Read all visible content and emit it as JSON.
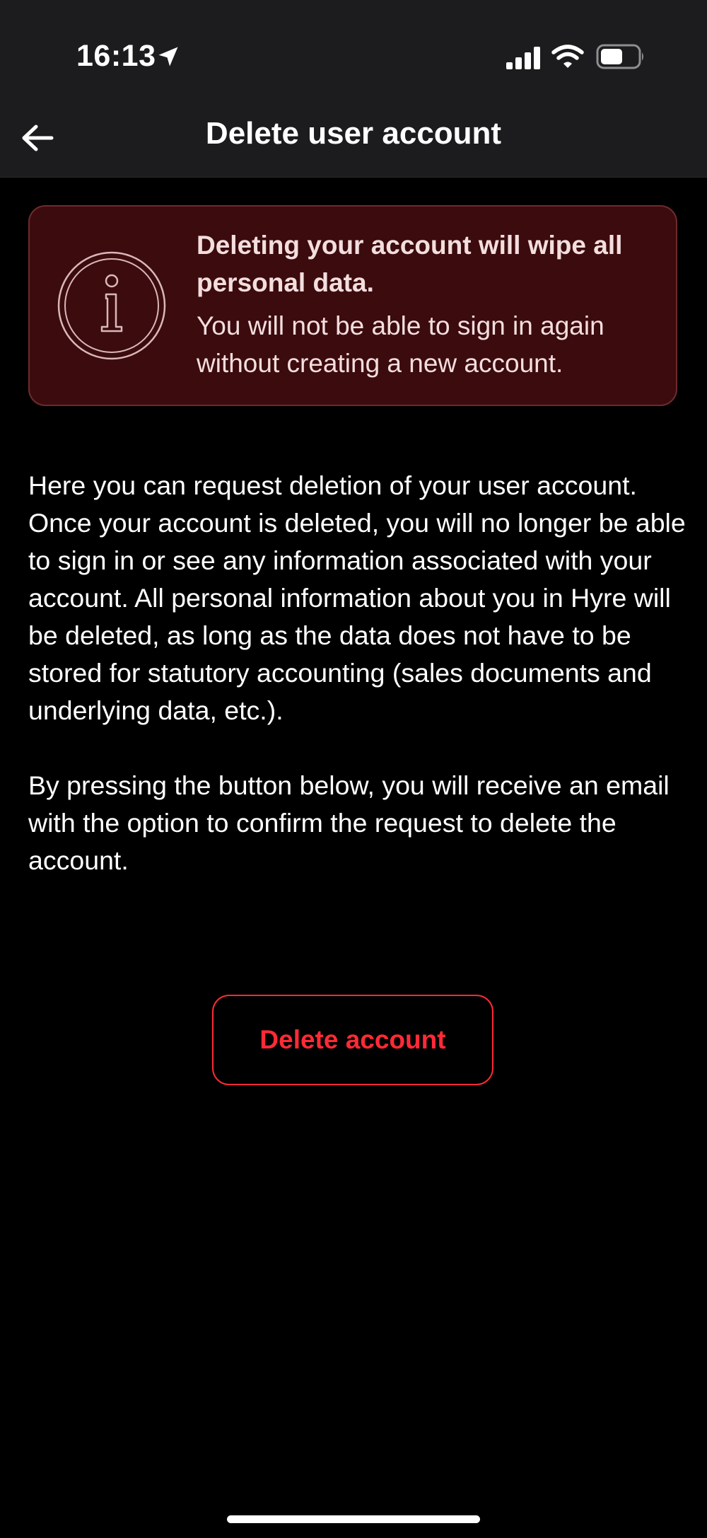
{
  "status_bar": {
    "time": "16:13",
    "icons": [
      "location-arrow-icon",
      "cellular-signal-icon",
      "wifi-icon",
      "battery-icon"
    ]
  },
  "header": {
    "back_icon": "arrow-left-icon",
    "title": "Delete user account"
  },
  "warning": {
    "icon": "info-icon",
    "title": "Deleting your account will wipe all personal data.",
    "body": "You will not be able to sign in again without creating a new account."
  },
  "description": {
    "paragraph_1": "Here you can request deletion of your user account. Once your account is deleted, you will no longer be able to sign in or see any information associated with your account. All personal information about you in Hyre will be deleted, as long as the data does not have to be stored for statutory accounting (sales documents and underlying data, etc.).",
    "paragraph_2": "By pressing the button below, you will receive an email with the option to confirm the request to delete the account."
  },
  "actions": {
    "delete_label": "Delete account"
  },
  "colors": {
    "background": "#000000",
    "header_background": "#1c1c1e",
    "warning_background": "#3c0b0e",
    "warning_border": "#6e2a2d",
    "accent_red": "#ff2a36"
  }
}
